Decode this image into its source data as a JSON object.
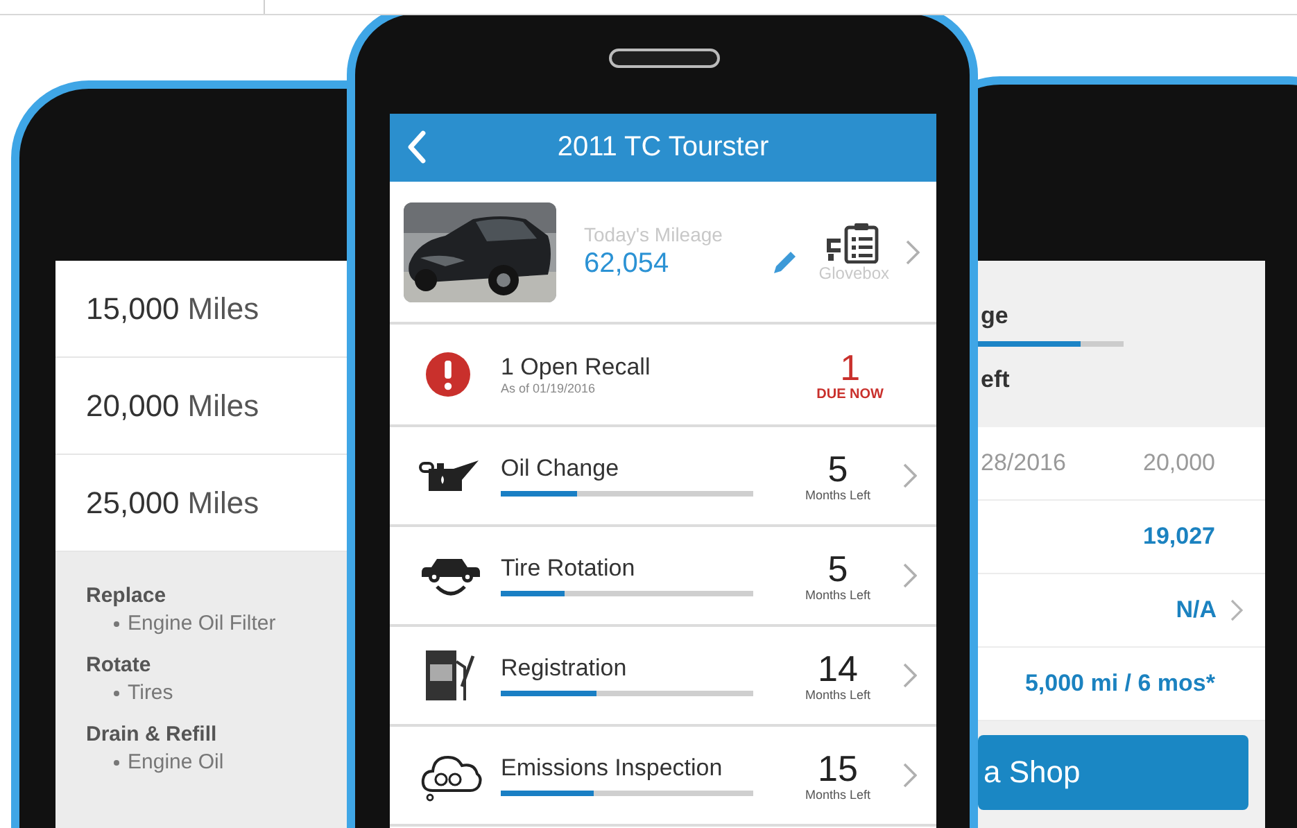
{
  "left_phone": {
    "mileage_rows": [
      {
        "miles": "15,000",
        "unit": "Miles"
      },
      {
        "miles": "20,000",
        "unit": "Miles"
      },
      {
        "miles": "25,000",
        "unit": "Miles"
      }
    ],
    "services": [
      {
        "action": "Replace",
        "items": [
          "Engine Oil Filter"
        ]
      },
      {
        "action": "Rotate",
        "items": [
          "Tires"
        ]
      },
      {
        "action": "Drain & Refill",
        "items": [
          "Engine Oil"
        ]
      }
    ]
  },
  "center_phone": {
    "title": "2011 TC Tourster",
    "vehicle": {
      "mileage_label": "Today's Mileage",
      "mileage": "62,054",
      "glovebox_label": "Glovebox"
    },
    "recall": {
      "title": "1 Open Recall",
      "date": "As of 01/19/2016",
      "count": "1",
      "status": "DUE NOW"
    },
    "maintenance": [
      {
        "kind": "oil",
        "name": "Oil Change",
        "level": 0.3,
        "count": "5",
        "unit": "Months Left"
      },
      {
        "kind": "tire",
        "name": "Tire Rotation",
        "level": 0.25,
        "count": "5",
        "unit": "Months Left"
      },
      {
        "kind": "registration",
        "name": "Registration",
        "level": 0.38,
        "count": "14",
        "unit": "Months Left"
      },
      {
        "kind": "emissions",
        "name": "Emissions Inspection",
        "level": 0.37,
        "count": "15",
        "unit": "Months Left"
      }
    ]
  },
  "right_phone": {
    "header_label": "ge",
    "level": 0.7,
    "header_sub": "eft",
    "rows": [
      {
        "kind": "date",
        "label": "28/2016",
        "value": "20,000",
        "chevron": false
      },
      {
        "kind": "value",
        "value": "19,027",
        "chevron": false
      },
      {
        "kind": "value",
        "value": "N/A",
        "chevron": true
      },
      {
        "kind": "value",
        "value": "5,000 mi / 6 mos*",
        "chevron": false
      }
    ],
    "button": "a Shop"
  }
}
